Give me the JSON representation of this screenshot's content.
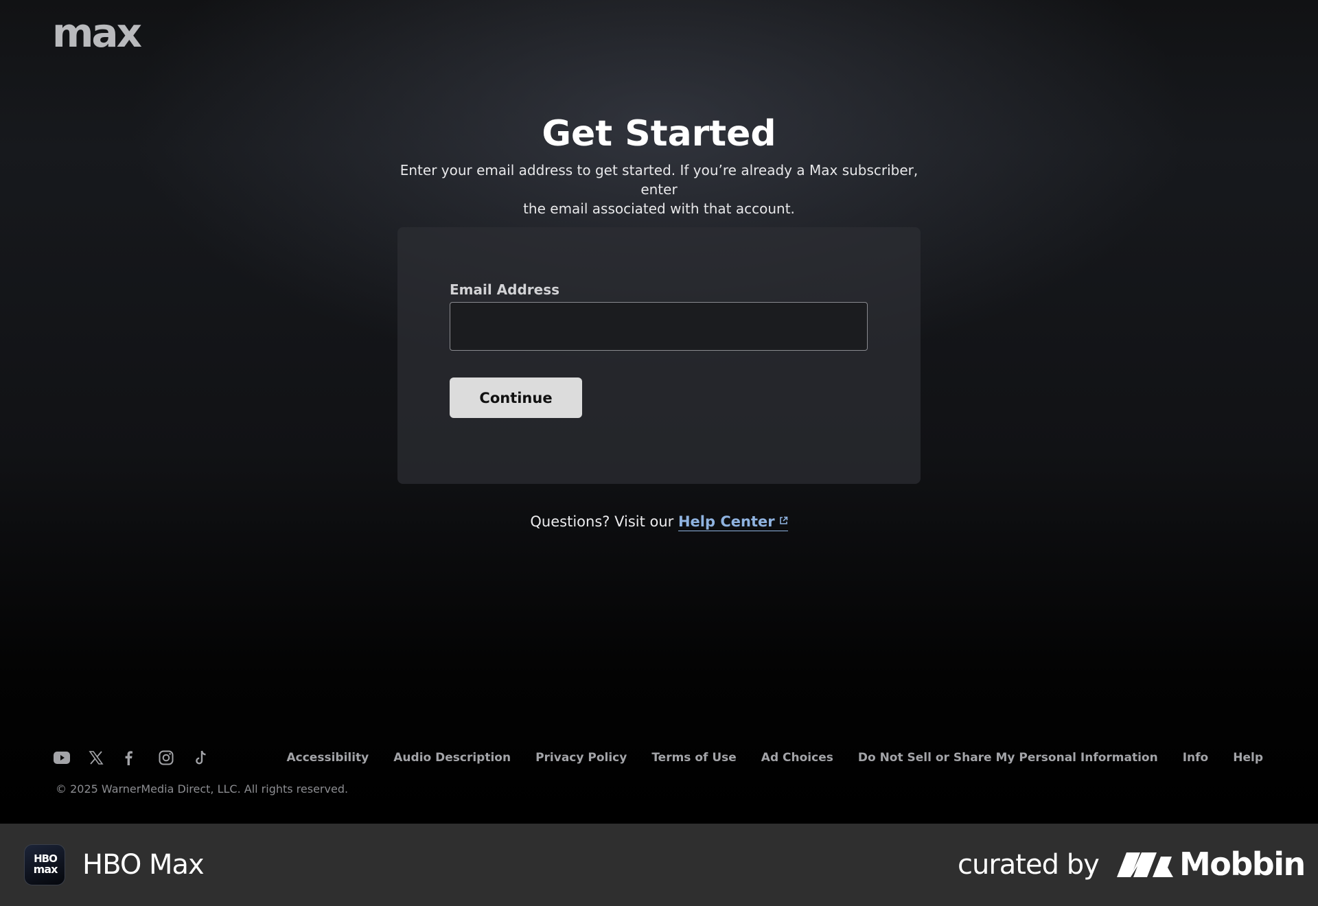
{
  "header": {
    "logo_text": "max"
  },
  "main": {
    "title": "Get Started",
    "subtitle_line1": "Enter your email address to get started. If you’re already a Max subscriber, enter",
    "subtitle_line2": "the email associated with that account.",
    "form": {
      "email_label": "Email Address",
      "email_value": "",
      "continue_label": "Continue"
    },
    "help": {
      "prefix": "Questions? Visit our",
      "link_label": "Help Center"
    }
  },
  "footer": {
    "socials": [
      "youtube-icon",
      "x-icon",
      "facebook-icon",
      "instagram-icon",
      "tiktok-icon"
    ],
    "links": [
      "Accessibility",
      "Audio Description",
      "Privacy Policy",
      "Terms of Use",
      "Ad Choices",
      "Do Not Sell or Share My Personal Information",
      "Info",
      "Help"
    ],
    "copyright": "© 2025 WarnerMedia Direct, LLC. All rights reserved."
  },
  "banner": {
    "app_icon_line1": "HBO",
    "app_icon_line2": "max",
    "app_name": "HBO Max",
    "curated_label": "curated by",
    "brand": "Mobbin"
  },
  "colors": {
    "background": "#000000",
    "card": "#2c2e33",
    "button": "#dcdcdc",
    "link": "#8fb3e0",
    "banner": "#2f2f2f"
  }
}
